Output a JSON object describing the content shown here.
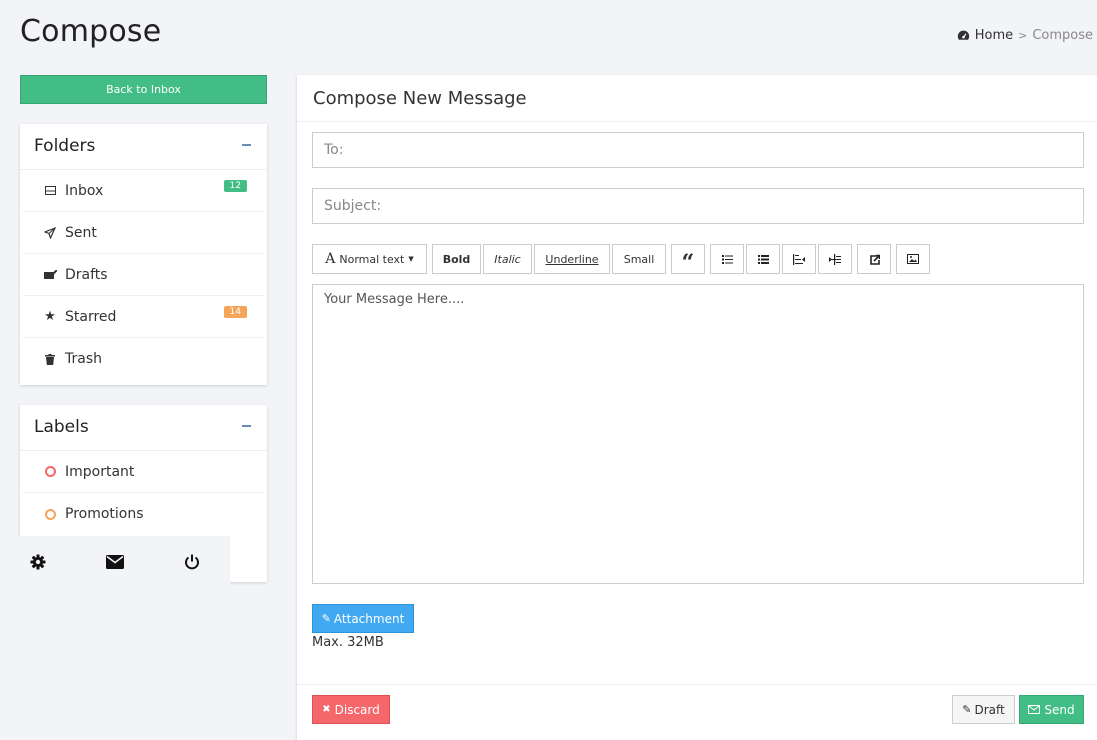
{
  "page_title": "Compose",
  "breadcrumb": {
    "home": "Home",
    "current": "Compose"
  },
  "back_button": "Back to Inbox",
  "folders": {
    "title": "Folders",
    "items": [
      {
        "label": "Inbox",
        "icon": "inbox-icon",
        "badge": "12",
        "badge_color": "#42bd85"
      },
      {
        "label": "Sent",
        "icon": "paper-plane-icon"
      },
      {
        "label": "Drafts",
        "icon": "envelope-pen-icon"
      },
      {
        "label": "Starred",
        "icon": "star-icon",
        "badge": "14",
        "badge_color": "#f5a55a"
      },
      {
        "label": "Trash",
        "icon": "trash-icon"
      }
    ]
  },
  "labels": {
    "title": "Labels",
    "items": [
      {
        "label": "Important",
        "color": "#f6676b"
      },
      {
        "label": "Promotions",
        "color": "#f5a55a"
      }
    ]
  },
  "bottom_bar": {
    "icons": [
      "gear-icon",
      "envelope-icon",
      "power-icon"
    ]
  },
  "compose": {
    "title": "Compose New Message",
    "to_placeholder": "To:",
    "subject_placeholder": "Subject:",
    "toolbar": {
      "font_style": "Normal text",
      "bold": "Bold",
      "italic": "Italic",
      "underline": "Underline",
      "small": "Small"
    },
    "message_placeholder": "Your Message Here....",
    "attachment_label": "Attachment",
    "max_size": "Max. 32MB",
    "discard_label": "Discard",
    "draft_label": "Draft",
    "send_label": "Send"
  },
  "colors": {
    "green": "#42bd85",
    "blue": "#41a9f2",
    "red": "#f6676b",
    "orange": "#f5a55a"
  }
}
